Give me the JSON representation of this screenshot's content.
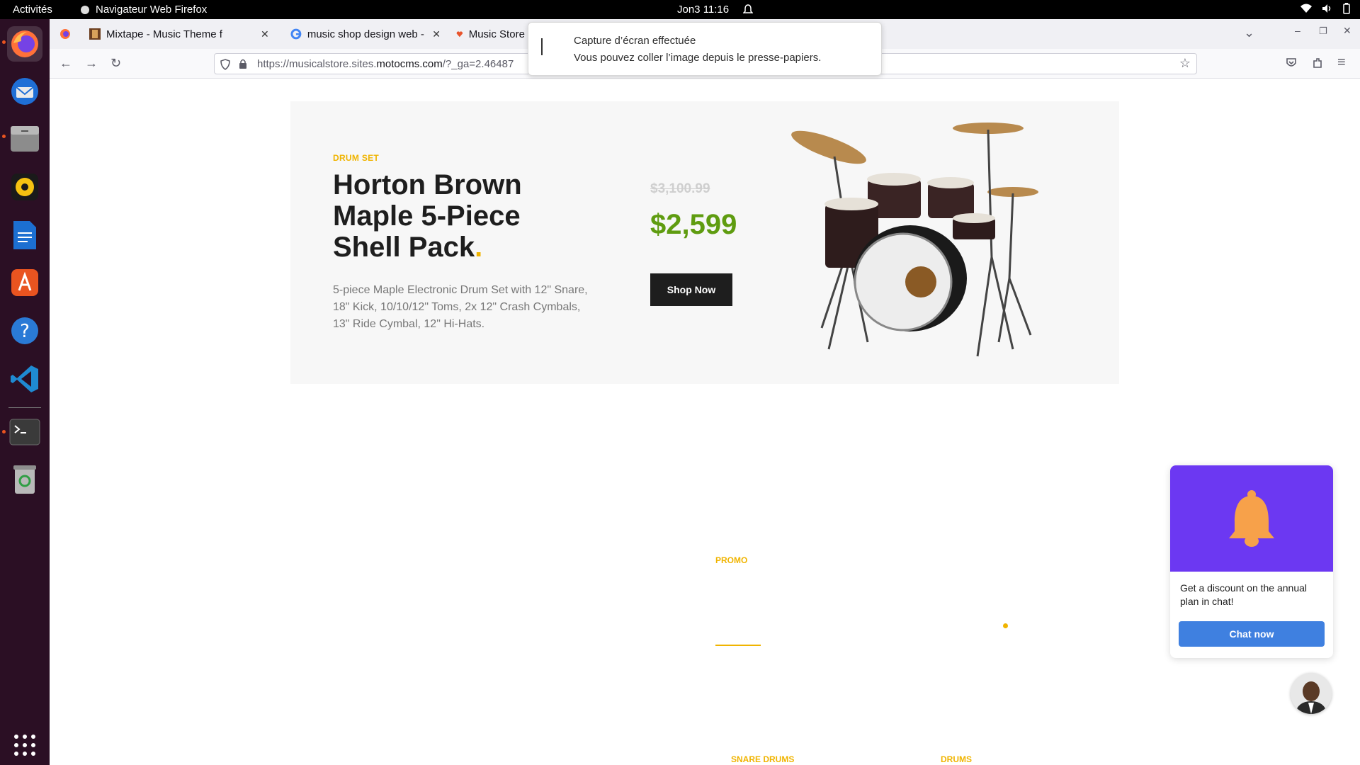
{
  "topbar": {
    "activities": "Activités",
    "app_name": "Navigateur Web Firefox",
    "clock": "Jon3  11:16"
  },
  "dock": {
    "apps": [
      "firefox-icon",
      "thunderbird-icon",
      "files-icon",
      "rhythmbox-icon",
      "writer-icon",
      "software-center-icon",
      "help-icon",
      "vscode-icon",
      "terminal-icon",
      "trash-icon",
      "app-grid-icon"
    ]
  },
  "browser": {
    "tabs": [
      {
        "label": "Mixtape - Music Theme f"
      },
      {
        "label": "music shop design web - "
      },
      {
        "label": "Music Store Website D"
      }
    ],
    "url_prefix": "https://musicalstore.sites.",
    "url_domain": "motocms.com",
    "url_suffix": "/?_ga=2.46487"
  },
  "notification": {
    "title": "Capture d’écran effectuée",
    "body": "Vous pouvez coller l’image depuis le presse-papiers."
  },
  "hero": {
    "kicker": "DRUM SET",
    "title": "Horton Brown Maple 5-Piece Shell Pack",
    "title_dot": ".",
    "description": "5-piece Maple Electronic Drum Set with 12\" Snare, 18\" Kick, 10/10/12\" Toms, 2x 12\" Crash Cymbals, 13\" Ride Cymbal, 12\" Hi-Hats.",
    "old_price": "$3,100.99",
    "price": "$2,599",
    "button": "Shop Now"
  },
  "promo": {
    "kicker": "PROMO"
  },
  "categories": [
    "SNARE DRUMS",
    "DRUMS"
  ],
  "chat": {
    "message": "Get a discount on the annual plan in chat!",
    "button": "Chat now"
  },
  "colors": {
    "accent": "#f0b400",
    "price_green": "#5f9c10",
    "chat_purple": "#6c38f2",
    "chat_blue": "#3f80e0",
    "dock_bg": "#2b0f24"
  }
}
